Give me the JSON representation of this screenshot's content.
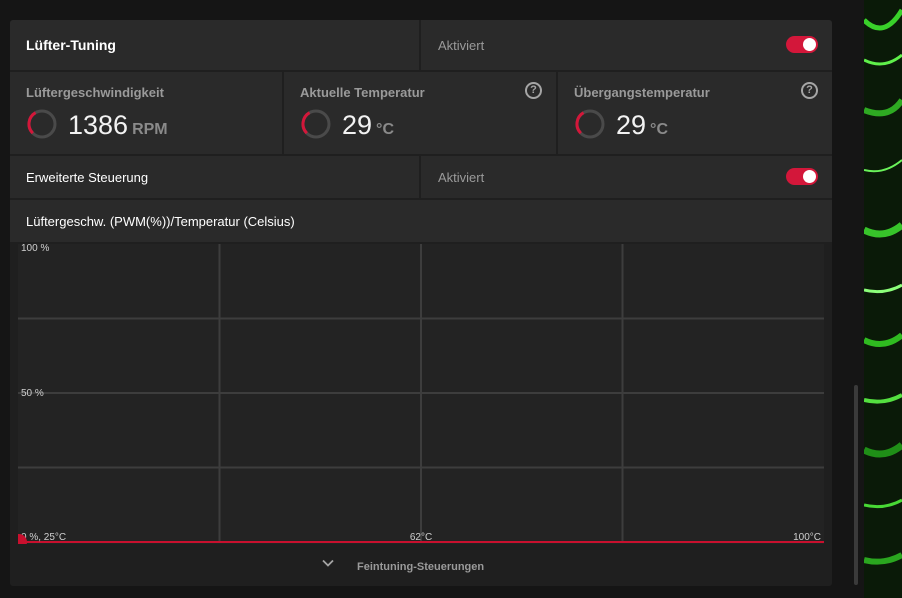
{
  "fan_tuning": {
    "label": "Lüfter-Tuning",
    "status": "Aktiviert",
    "enabled": true
  },
  "metrics": [
    {
      "label": "Lüftergeschwindigkeit",
      "value": "1386",
      "unit": "RPM",
      "help": false
    },
    {
      "label": "Aktuelle Temperatur",
      "value": "29",
      "unit": "°C",
      "help": true
    },
    {
      "label": "Übergangstemperatur",
      "value": "29",
      "unit": "°C",
      "help": true
    }
  ],
  "advanced": {
    "label": "Erweiterte Steuerung",
    "status": "Aktiviert",
    "enabled": true
  },
  "chart_header": "Lüftergeschw. (PWM(%))/Temperatur (Celsius)",
  "help_glyph": "?",
  "chart_data": {
    "type": "line",
    "y_tick_labels": [
      "100 %",
      "50 %"
    ],
    "x_tick_labels": [
      "0 %, 25°C",
      "62°C",
      "100°C"
    ],
    "xlim": [
      25,
      100
    ],
    "ylim": [
      0,
      100
    ],
    "grid": true,
    "series": [
      {
        "x": [
          25,
          100
        ],
        "y": [
          0,
          0
        ]
      }
    ],
    "point": {
      "x": 25,
      "y": 0
    },
    "line_color": "#c8102e"
  },
  "footer": {
    "label": "Feintuning-Steuerungen"
  },
  "colors": {
    "accent": "#d3173a",
    "panel": "#2a2a2a",
    "background": "#1f1f1f"
  }
}
